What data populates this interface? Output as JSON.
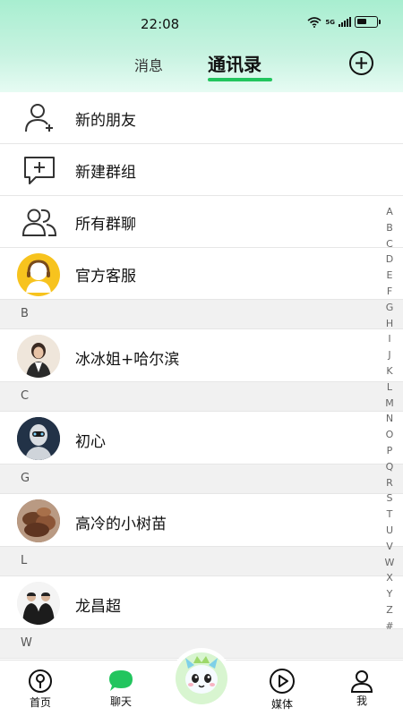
{
  "status_bar": {
    "time": "22:08",
    "network": "5G",
    "battery_level": 0.55
  },
  "header": {
    "tab_messages": "消息",
    "tab_contacts": "通讯录",
    "add_icon": "plus-circle-icon"
  },
  "actions": [
    {
      "label": "新的朋友",
      "icon": "add-friend-icon"
    },
    {
      "label": "新建群组",
      "icon": "new-group-icon"
    },
    {
      "label": "所有群聊",
      "icon": "groups-icon"
    },
    {
      "label": "官方客服",
      "icon": "customer-service-avatar"
    }
  ],
  "sections": [
    {
      "letter": "B",
      "contacts": [
        {
          "name": "冰冰姐+哈尔滨"
        }
      ]
    },
    {
      "letter": "C",
      "contacts": [
        {
          "name": "初心"
        }
      ]
    },
    {
      "letter": "G",
      "contacts": [
        {
          "name": "高冷的小树苗"
        }
      ]
    },
    {
      "letter": "L",
      "contacts": [
        {
          "name": "龙昌超"
        }
      ]
    },
    {
      "letter": "W",
      "contacts": []
    }
  ],
  "index_letters": [
    "A",
    "B",
    "C",
    "D",
    "E",
    "F",
    "G",
    "H",
    "I",
    "J",
    "K",
    "L",
    "M",
    "N",
    "O",
    "P",
    "Q",
    "R",
    "S",
    "T",
    "U",
    "V",
    "W",
    "X",
    "Y",
    "Z",
    "#"
  ],
  "bottom_nav": [
    {
      "label": "首页",
      "icon": "home-icon"
    },
    {
      "label": "聊天",
      "icon": "chat-icon"
    },
    {
      "label": "",
      "icon": "mascot-icon"
    },
    {
      "label": "媒体",
      "icon": "play-icon"
    },
    {
      "label": "我",
      "icon": "profile-icon"
    }
  ],
  "colors": {
    "accent": "#22c55e",
    "header_top": "#a8eed0",
    "section_bg": "#f1f1f1"
  }
}
